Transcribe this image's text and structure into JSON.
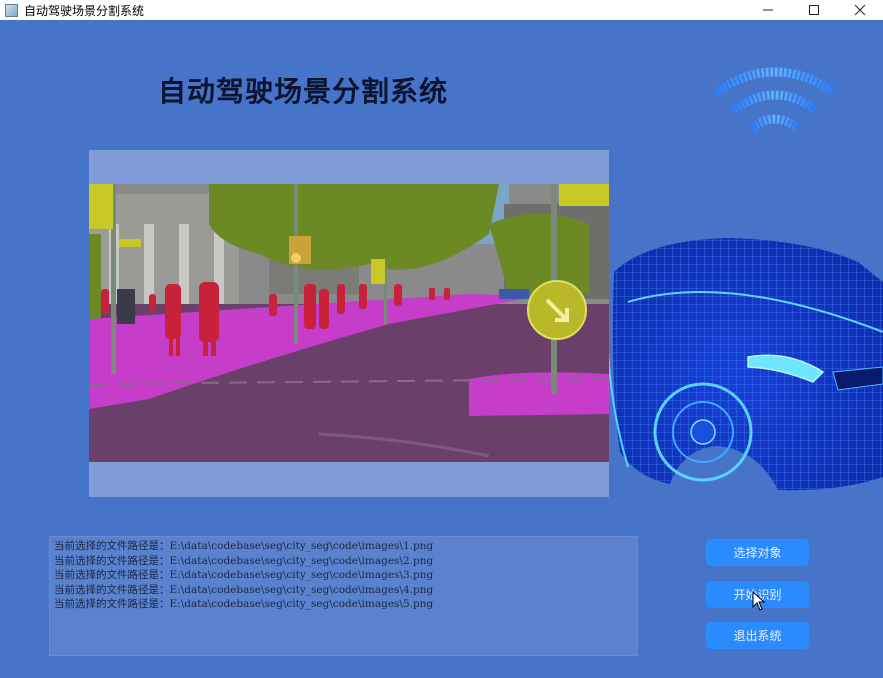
{
  "window": {
    "title": "自动驾驶场景分割系统"
  },
  "header": {
    "title": "自动驾驶场景分割系统"
  },
  "log": {
    "lines": [
      "当前选择的文件路径是：E:\\data\\codebase\\seg\\city_seg\\code\\images\\1.png",
      "当前选择的文件路径是：E:\\data\\codebase\\seg\\city_seg\\code\\images\\2.png",
      "当前选择的文件路径是：E:\\data\\codebase\\seg\\city_seg\\code\\images\\3.png",
      "当前选择的文件路径是：E:\\data\\codebase\\seg\\city_seg\\code\\images\\4.png",
      "当前选择的文件路径是：E:\\data\\codebase\\seg\\city_seg\\code\\images\\5.png"
    ]
  },
  "buttons": {
    "select": "选择对象",
    "start": "开始识别",
    "exit": "退出系统"
  },
  "colors": {
    "background": "#4674c8",
    "button": "#2a8bff",
    "panel": "#7f9cd8",
    "road": "#6a3f6a",
    "sidewalk": "#c53dc8",
    "vegetation": "#6b8a23",
    "person": "#c8213a",
    "building": "#8a8a8a",
    "sky": "#79a6c8"
  },
  "icons": {
    "wifi": "wifi-icon",
    "app": "app-icon",
    "minimize": "minimize-icon",
    "maximize": "maximize-icon",
    "close": "close-icon",
    "cursor": "cursor-icon"
  }
}
